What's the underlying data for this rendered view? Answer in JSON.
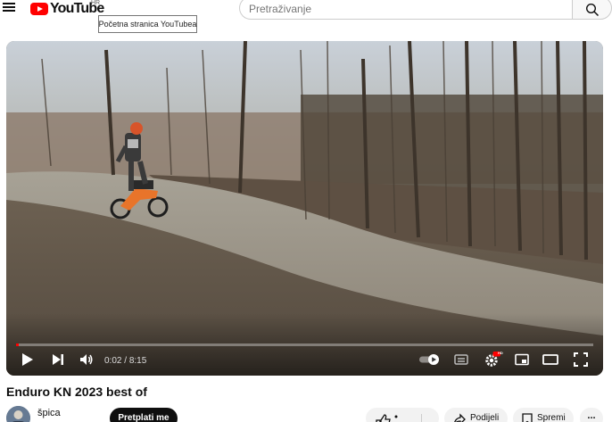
{
  "header": {
    "logo_text": "YouTube",
    "region": "HR",
    "home_tooltip": "Početna stranica YouTubea",
    "search_placeholder": "Pretraživanje",
    "icons": [
      "menu-icon",
      "youtube-logo-icon",
      "search-icon"
    ]
  },
  "player": {
    "current_time": "0:02",
    "separator": "/",
    "duration": "8:15",
    "progress_fraction": 0.004,
    "settings_badge": "HD",
    "icons": [
      "play-icon",
      "next-icon",
      "volume-icon",
      "autoplay-toggle-icon",
      "subtitles-icon",
      "settings-icon",
      "miniplayer-icon",
      "theater-mode-icon",
      "fullscreen-icon"
    ],
    "accent_color": "#ff0000"
  },
  "video": {
    "title": "Enduro KN 2023 best of",
    "channel": "špica",
    "subscribe_label": "Pretplati me",
    "share_label": "Podijeli",
    "save_label": "Spremi",
    "more_label": "..."
  }
}
